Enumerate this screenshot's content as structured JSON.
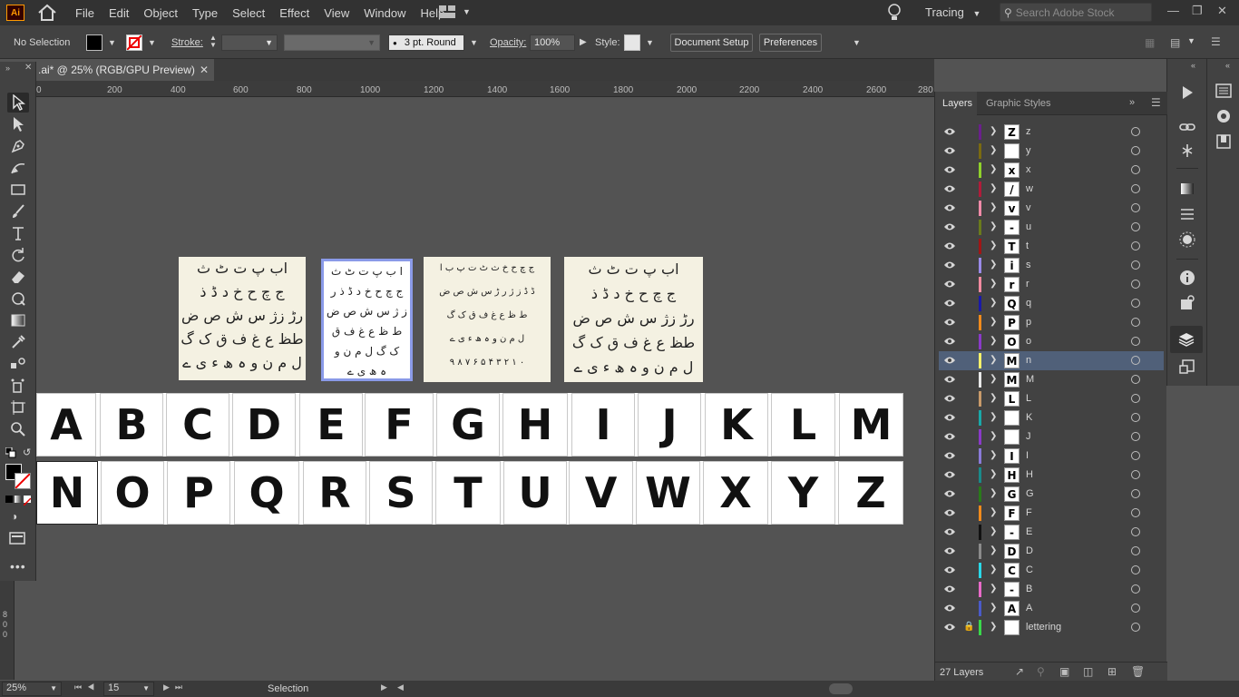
{
  "menubar": {
    "app_logo": "Ai",
    "items": [
      "File",
      "Edit",
      "Object",
      "Type",
      "Select",
      "Effect",
      "View",
      "Window",
      "Help"
    ],
    "workspace": "Tracing",
    "search_placeholder": "Search Adobe Stock"
  },
  "control": {
    "selection": "No Selection",
    "stroke_label": "Stroke:",
    "brush": "3 pt. Round",
    "opacity_label": "Opacity:",
    "opacity_value": "100%",
    "style_label": "Style:",
    "document_setup": "Document Setup",
    "preferences": "Preferences"
  },
  "document": {
    "tab_title": ".ai* @ 25% (RGB/GPU Preview)"
  },
  "ruler": {
    "marks": [
      "0",
      "200",
      "400",
      "600",
      "800",
      "1000",
      "1200",
      "1400",
      "1600",
      "1800",
      "2000",
      "2200",
      "2400",
      "2600",
      "280"
    ],
    "vmarks": [
      "8",
      "0",
      "0"
    ]
  },
  "canvas": {
    "urdu_refs": [
      {
        "lines": [
          "اب پ ت ٹ ث",
          "ج چ ح خ د ڈ ذ",
          "رڑ زژ س ش ص ض",
          "طظ ع غ ف ق ک گ",
          "ل م ن و ہ ھ ء ی ے"
        ]
      },
      {
        "lines": [
          "ا ب پ ت ٹ ث",
          "ج چ ح خ د ڈ ذ ر",
          "ز ژ س ش ص ض",
          "ط ظ ع غ ف ق",
          "ک گ ل م ن و",
          "ہ ھ ی ے"
        ]
      },
      {
        "lines": [
          "ج چ ح خ ث ٹ ت پ ب ا",
          "ڈ ڈ ز ژ ر ڑ س ش ص ض",
          "ط ظ ع غ ف ق ک گ",
          "ل م ن و ہ ھ ء ی ے",
          "۰ ۱ ۲ ۳ ۴ ۵ ۶ ۷ ۸ ۹"
        ]
      },
      {
        "lines": [
          "اب پ ت ٹ ث",
          "ج چ ح خ د ڈ ذ",
          "رڑ زژ س ش ص ض",
          "طظ ع غ ف ق ک گ",
          "ل م ن و ہ ھ ء ی ے"
        ]
      }
    ],
    "row1": [
      "A",
      "B",
      "C",
      "D",
      "E",
      "F",
      "G",
      "H",
      "I",
      "J",
      "K",
      "L",
      "M"
    ],
    "row2": [
      "N",
      "O",
      "P",
      "Q",
      "R",
      "S",
      "T",
      "U",
      "V",
      "W",
      "X",
      "Y",
      "Z"
    ]
  },
  "layers_panel": {
    "tab_layers": "Layers",
    "tab_graphic_styles": "Graphic Styles",
    "layers": [
      {
        "name": "z",
        "color": "#6a1f8c",
        "thumb": "Z"
      },
      {
        "name": "y",
        "color": "#7a6a10",
        "thumb": ""
      },
      {
        "name": "x",
        "color": "#8fd12b",
        "thumb": "x"
      },
      {
        "name": "w",
        "color": "#b01c3a",
        "thumb": "/"
      },
      {
        "name": "v",
        "color": "#f08aa8",
        "thumb": "v"
      },
      {
        "name": "u",
        "color": "#6a7a1c",
        "thumb": "-"
      },
      {
        "name": "t",
        "color": "#a01616",
        "thumb": "T"
      },
      {
        "name": "s",
        "color": "#9a8ae8",
        "thumb": "i"
      },
      {
        "name": "r",
        "color": "#f28aa0",
        "thumb": "r"
      },
      {
        "name": "q",
        "color": "#1a1aa8",
        "thumb": "Q"
      },
      {
        "name": "p",
        "color": "#f08a1c",
        "thumb": "P"
      },
      {
        "name": "o",
        "color": "#8a3ac8",
        "thumb": "O"
      },
      {
        "name": "n",
        "color": "#f4f06a",
        "thumb": "M",
        "selected": true
      },
      {
        "name": "M",
        "color": "#e8e8e8",
        "thumb": "M"
      },
      {
        "name": "L",
        "color": "#c89a6a",
        "thumb": "L"
      },
      {
        "name": "K",
        "color": "#1aa8a8",
        "thumb": ""
      },
      {
        "name": "J",
        "color": "#8a3ac8",
        "thumb": ""
      },
      {
        "name": "I",
        "color": "#8a7ad8",
        "thumb": "I"
      },
      {
        "name": "H",
        "color": "#1a8a8a",
        "thumb": "H"
      },
      {
        "name": "G",
        "color": "#2a7a1a",
        "thumb": "G"
      },
      {
        "name": "F",
        "color": "#f08a1c",
        "thumb": "F"
      },
      {
        "name": "E",
        "color": "#111111",
        "thumb": "-"
      },
      {
        "name": "D",
        "color": "#8a8a8a",
        "thumb": "D"
      },
      {
        "name": "C",
        "color": "#2ad8e8",
        "thumb": "C"
      },
      {
        "name": "B",
        "color": "#e86ac8",
        "thumb": "-"
      },
      {
        "name": "A",
        "color": "#4a5ac8",
        "thumb": "A"
      },
      {
        "name": "lettering",
        "color": "#3ad84a",
        "thumb": "",
        "locked": true
      }
    ],
    "layer_count": "27 Layers"
  },
  "status": {
    "zoom": "25%",
    "artboard": "15",
    "tool": "Selection"
  }
}
